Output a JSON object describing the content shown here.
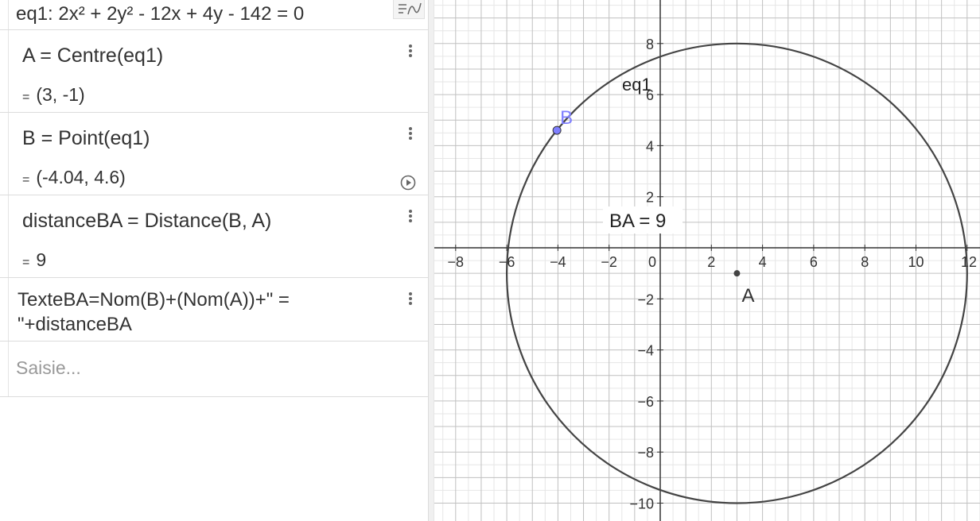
{
  "algebra": {
    "rows": [
      {
        "definition": "eq1: 2x² + 2y² - 12x + 4y - 142 = 0",
        "value": ""
      },
      {
        "definition": "A = Centre(eq1)",
        "value": "(3, -1)"
      },
      {
        "definition": "B = Point(eq1)",
        "value": "(-4.04, 4.6)"
      },
      {
        "definition": "distanceBA = Distance(B, A)",
        "value": "9"
      },
      {
        "definition_line1": "TexteBA=Nom(B)+(Nom(A))+\" =",
        "definition_line2": "\"+distanceBA"
      }
    ],
    "value_prefix": "=",
    "input_placeholder": "Saisie..."
  },
  "graphics": {
    "x_ticks": [
      "−8",
      "−6",
      "−4",
      "−2",
      "0",
      "2",
      "4",
      "6",
      "8",
      "10",
      "12"
    ],
    "y_ticks": [
      "8",
      "6",
      "4",
      "2",
      "−2",
      "−4",
      "−6",
      "−8",
      "−10"
    ],
    "labels": {
      "conic": "eq1",
      "point_a": "A",
      "point_b": "B",
      "text_ba": "BA = 9"
    },
    "objects": {
      "circle_center": [
        3,
        -1
      ],
      "circle_radius": 9,
      "point_a": [
        3,
        -1
      ],
      "point_b": [
        -4.04,
        4.6
      ]
    },
    "colors": {
      "circle": "#444444",
      "point_a": "#444444",
      "point_b": "#7f7fff",
      "point_b_label": "#7f7fff",
      "grid_major": "#c0c0c0",
      "grid_minor": "#e6e6e6",
      "axes": "#333333"
    }
  }
}
